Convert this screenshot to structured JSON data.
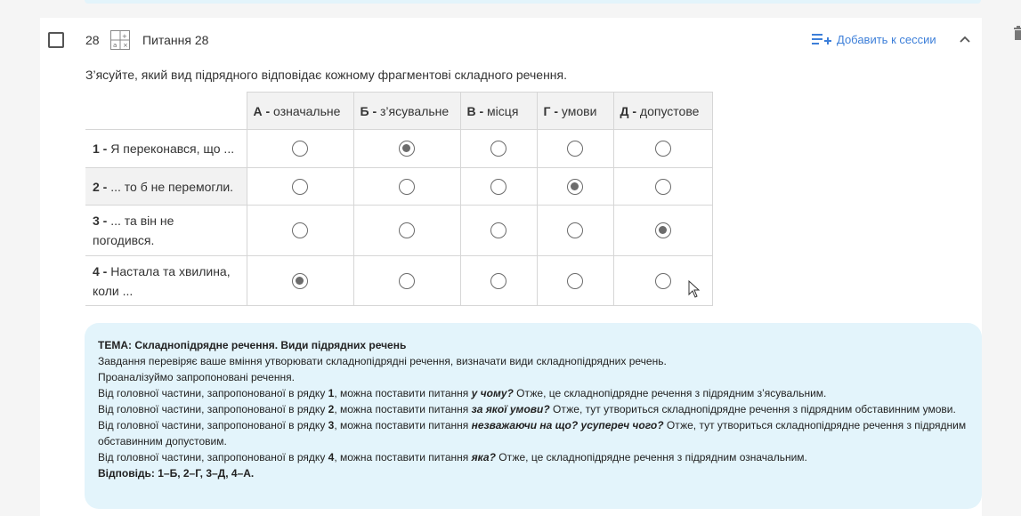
{
  "question": {
    "number": "28",
    "title": "Питання 28",
    "add_to_session": "Добавить к сессии",
    "prompt": "З’ясуйте, який вид підрядного відповідає кожному фрагментові складного речення."
  },
  "columns": [
    {
      "key": "А -",
      "label": " означальне"
    },
    {
      "key": "Б -",
      "label": " з’ясувальне"
    },
    {
      "key": "В -",
      "label": " місця"
    },
    {
      "key": "Г -",
      "label": " умови"
    },
    {
      "key": "Д -",
      "label": " допустове"
    }
  ],
  "rows": [
    {
      "key": "1 -",
      "text": " Я переконався, що ...",
      "selected": 1
    },
    {
      "key": "2 -",
      "text": " ... то б не перемогли.",
      "selected": 3
    },
    {
      "key": "3 -",
      "text": " ... та він не погодився.",
      "selected": 4
    },
    {
      "key": "4 -",
      "text": " Настала та хвилина, коли ...",
      "selected": 0
    }
  ],
  "explanation": {
    "heading": "ТЕМА: Складнопідрядне речення. Види підрядних речень",
    "p1": "Завдання перевіряє ваше вміння утворювати складнопідрядні речення, визначати види складнопідрядних речень.",
    "p2": "Проаналізуймо запропоновані речення.",
    "line_prefix": "Від головної частини, запропонованої в рядку ",
    "line_mid": ", можна поставити питання ",
    "l1_num": "1",
    "l1_q": "у чому?",
    "l1_rest": " Отже, це складнопідрядне речення з підрядним з’ясувальним.",
    "l2_num": "2",
    "l2_q": "за якої умови?",
    "l2_rest": " Отже, тут утвориться складнопідрядне речення з підрядним обставинним умови.",
    "l3_num": "3",
    "l3_q": "незважаючи на що? усупереч чого?",
    "l3_rest": " Отже, тут утвориться складнопідрядне речення з підрядним обставинним допустовим.",
    "l4_num": "4",
    "l4_q": "яка?",
    "l4_rest": " Отже, це складнопідрядне речення з підрядним означальним.",
    "answer": "Відповідь: 1–Б, 2–Г, 3–Д, 4–А."
  },
  "colors": {
    "accent": "#3d7fd9",
    "explain_bg": "#e3f4fb",
    "header_bg": "#f2f2f2"
  }
}
